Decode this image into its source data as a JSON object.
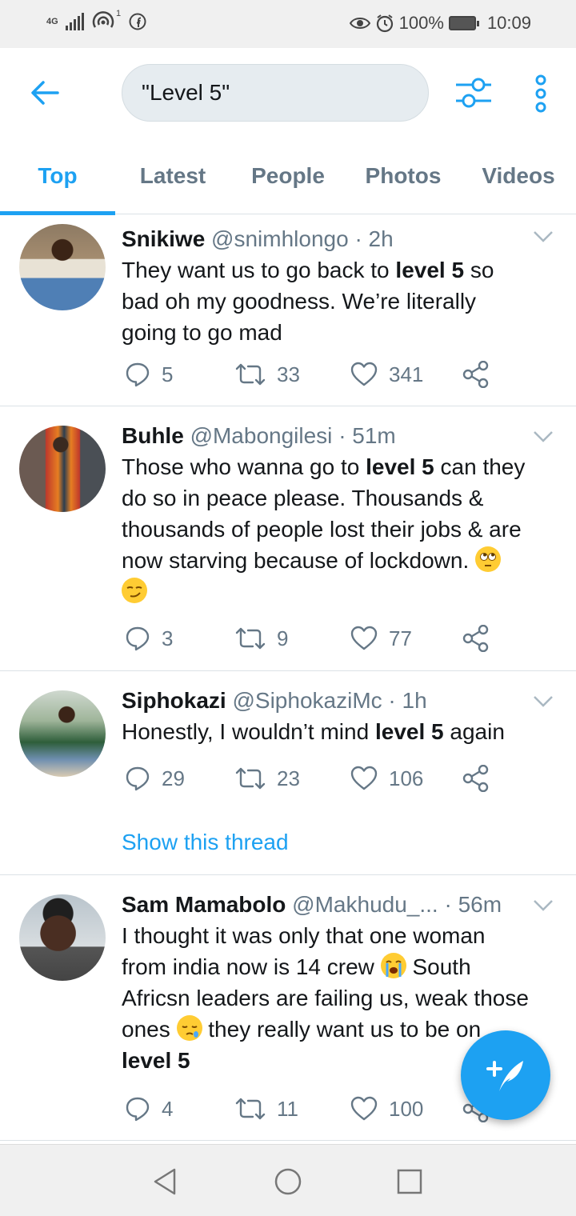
{
  "status_bar": {
    "network": "4G",
    "notification_count": "1",
    "battery": "100%",
    "time": "10:09"
  },
  "search": {
    "query": "\"Level 5\""
  },
  "tabs": [
    "Top",
    "Latest",
    "People",
    "Photos",
    "Videos"
  ],
  "active_tab": "Top",
  "tweets": [
    {
      "name": "Snikiwe",
      "handle": "@snimhlongo",
      "time": "· 2h",
      "text_lines": [
        [
          "They want us to go back to ",
          "level 5",
          " so"
        ],
        [
          "bad oh my goodness. We’re literally",
          "",
          ""
        ],
        [
          "going to go mad",
          "",
          ""
        ]
      ],
      "replies": "5",
      "retweets": "33",
      "likes": "341"
    },
    {
      "name": "Buhle",
      "handle": "@Mabongilesi",
      "time": "· 51m",
      "text_lines": [
        [
          "Those who wanna go to ",
          "level 5",
          " can they"
        ],
        [
          "do so in peace please. Thousands &",
          "",
          ""
        ],
        [
          "thousands of people lost their jobs & are",
          "",
          ""
        ],
        [
          "now starving because of lockdown.",
          "",
          ""
        ]
      ],
      "emojis": [
        "face-with-rolling-eyes-emoji",
        "smirking-face-emoji"
      ],
      "replies": "3",
      "retweets": "9",
      "likes": "77"
    },
    {
      "name": "Siphokazi",
      "handle": "@SiphokaziMc",
      "time": "· 1h",
      "text_lines": [
        [
          "Honestly, I wouldn’t mind ",
          "level 5",
          " again"
        ]
      ],
      "replies": "29",
      "retweets": "23",
      "likes": "106",
      "show_thread": "Show this thread"
    },
    {
      "name": "Sam Mamabolo",
      "handle": "@Makhudu_...",
      "time": "· 56m",
      "text_lines": [
        [
          "I thought it was only that one woman",
          "",
          ""
        ],
        [
          "from india now is 14 crew",
          "",
          ""
        ],
        [
          "South",
          "",
          ""
        ],
        [
          "Africsn leaders are failing us, weak those",
          "",
          ""
        ],
        [
          "ones",
          "",
          ""
        ],
        [
          "they really want us to be on",
          "",
          ""
        ],
        [
          "",
          "level 5",
          ""
        ]
      ],
      "emojis": [
        "loudly-crying-face-emoji",
        "sleepy-face-emoji"
      ],
      "replies": "4",
      "retweets": "11",
      "likes": "100"
    }
  ],
  "colors": {
    "accent": "#1da1f2",
    "text": "#14171a",
    "muted": "#657786",
    "divider": "#dbe2e6"
  }
}
